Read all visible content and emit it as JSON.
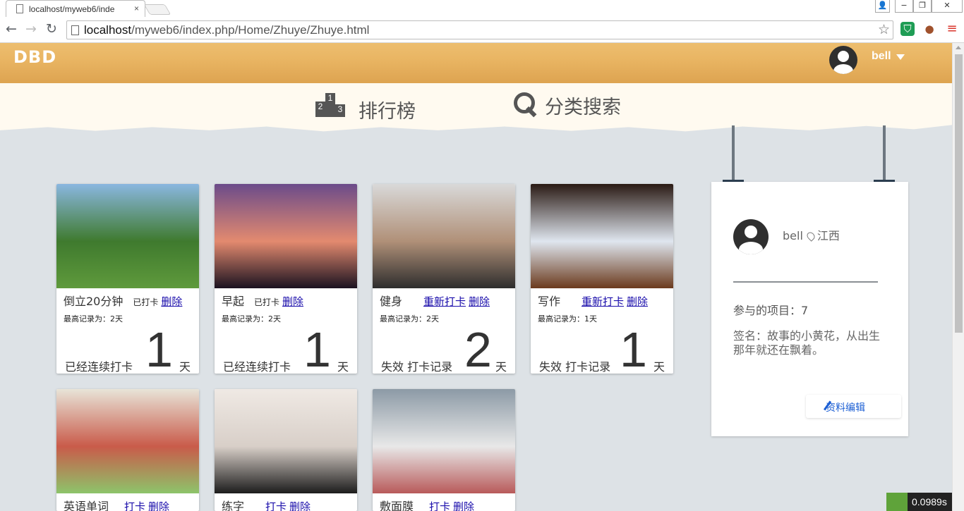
{
  "browser": {
    "tab_title": "localhost/myweb6/inde",
    "tab_close": "×",
    "url_host": "localhost",
    "url_path": "/myweb6/index.php/Home/Zhuye/Zhuye.html",
    "window_controls": [
      "👤",
      "−",
      "❐",
      "✕"
    ]
  },
  "header": {
    "logo": "DBD",
    "user_name": "bell"
  },
  "subnav": {
    "rank_label": "排行榜",
    "rank_icon_numbers": [
      "2",
      "1",
      "3"
    ],
    "search_label": "分类搜索"
  },
  "cards": [
    {
      "title": "倒立20分钟",
      "status": "已打卡",
      "links": [
        "删除"
      ],
      "record": "最高记录为：2天",
      "streak_label": "已经连续打卡",
      "streak": "1",
      "unit": "天",
      "photo_colors": [
        "#8ab7e0",
        "#3f7a2e",
        "#5f9a3c"
      ]
    },
    {
      "title": "早起",
      "status": "已打卡",
      "links": [
        "删除"
      ],
      "record": "最高记录为：2天",
      "streak_label": "已经连续打卡",
      "streak": "1",
      "unit": "天",
      "photo_colors": [
        "#6b4b8a",
        "#e38a6f",
        "#1a1220"
      ]
    },
    {
      "title": "健身",
      "status": "",
      "links": [
        "重新打卡",
        "删除"
      ],
      "record": "最高记录为：2天",
      "streak_label": "失效 打卡记录",
      "streak": "2",
      "unit": "天",
      "photo_colors": [
        "#d9d9d9",
        "#b09078",
        "#2d2d2d"
      ]
    },
    {
      "title": "写作",
      "status": "",
      "links": [
        "重新打卡",
        "删除"
      ],
      "record": "最高记录为：1天",
      "streak_label": "失效 打卡记录",
      "streak": "1",
      "unit": "天",
      "photo_colors": [
        "#2a1a14",
        "#dfe6ef",
        "#6b3a1d"
      ]
    },
    {
      "title": "英语单词",
      "status": "",
      "links": [
        "打卡",
        "删除"
      ],
      "record": "",
      "streak_label": "",
      "streak": "",
      "unit": "",
      "photo_colors": [
        "#e8e4d8",
        "#c95b4a",
        "#8dc46a"
      ]
    },
    {
      "title": "练字",
      "status": "",
      "links": [
        "打卡",
        "删除"
      ],
      "record": "",
      "streak_label": "",
      "streak": "",
      "unit": "",
      "photo_colors": [
        "#efe9e4",
        "#d8cfc8",
        "#1c1c1c"
      ]
    },
    {
      "title": "敷面膜",
      "status": "",
      "links": [
        "打卡",
        "删除"
      ],
      "record": "",
      "streak_label": "",
      "streak": "",
      "unit": "",
      "photo_colors": [
        "#8c9aa6",
        "#e8e8e8",
        "#b85a5a"
      ]
    }
  ],
  "profile": {
    "name": "bell",
    "location": "江西",
    "projects": "参与的项目：7",
    "signature": "签名：故事的小黄花，从出生那年就还在飘着。",
    "edit_button": "资料编辑"
  },
  "perf_badge": "0.0989s"
}
